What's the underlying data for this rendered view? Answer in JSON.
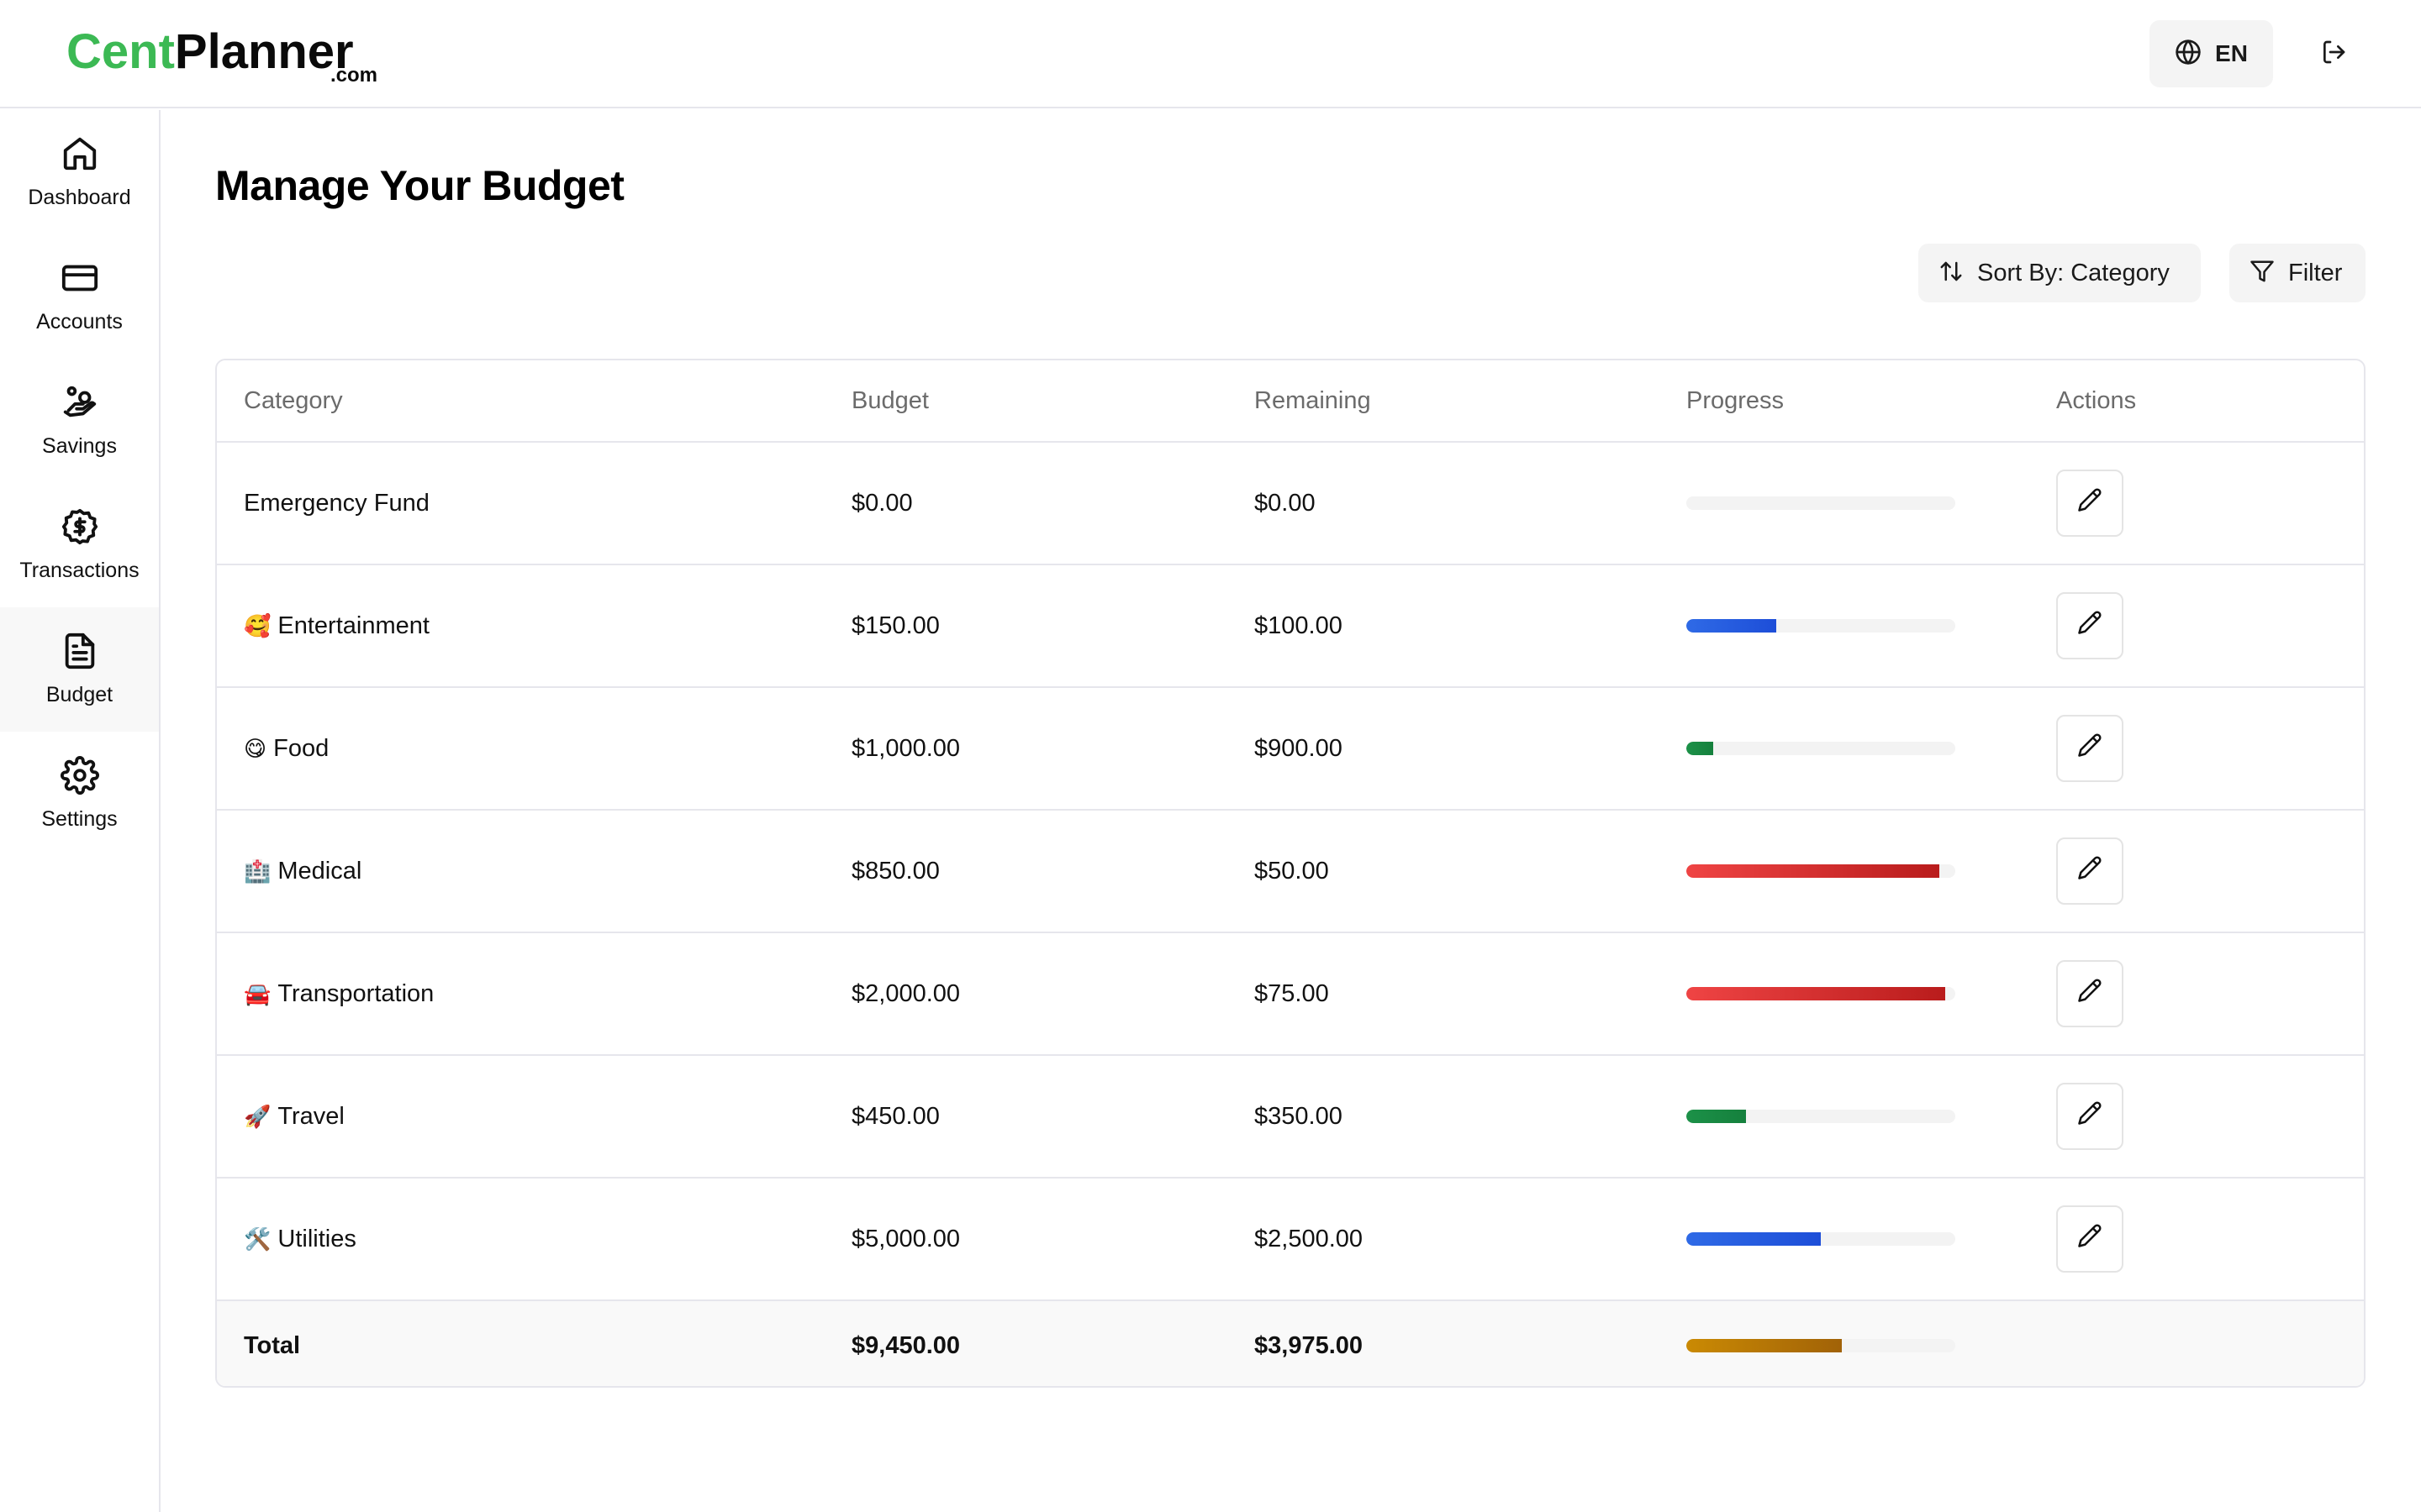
{
  "app": {
    "logo_part1": "Cent",
    "logo_part2": "Planner",
    "logo_suffix": ".com",
    "brand_color": "#3cb954"
  },
  "topbar": {
    "language_label": "EN",
    "language_icon": "globe-icon",
    "logout_icon": "logout-icon"
  },
  "sidebar": {
    "items": [
      {
        "label": "Dashboard",
        "icon": "home-icon",
        "active": false
      },
      {
        "label": "Accounts",
        "icon": "credit-card-icon",
        "active": false
      },
      {
        "label": "Savings",
        "icon": "hand-coins-icon",
        "active": false
      },
      {
        "label": "Transactions",
        "icon": "dollar-badge-icon",
        "active": false
      },
      {
        "label": "Budget",
        "icon": "file-text-icon",
        "active": true
      },
      {
        "label": "Settings",
        "icon": "gear-icon",
        "active": false
      }
    ]
  },
  "main": {
    "title": "Manage Your Budget",
    "sort_label": "Sort By: Category",
    "filter_label": "Filter"
  },
  "table": {
    "headers": {
      "category": "Category",
      "budget": "Budget",
      "remaining": "Remaining",
      "progress": "Progress",
      "actions": "Actions"
    },
    "rows": [
      {
        "emoji": "",
        "category": "Emergency Fund",
        "budget": "$0.00",
        "remaining": "$0.00",
        "progress_pct": 0,
        "bar_color": "green"
      },
      {
        "emoji": "🥰",
        "category": "Entertainment",
        "budget": "$150.00",
        "remaining": "$100.00",
        "progress_pct": 33.3,
        "bar_color": "blue"
      },
      {
        "emoji": "😋",
        "category": "Food",
        "budget": "$1,000.00",
        "remaining": "$900.00",
        "progress_pct": 10,
        "bar_color": "green"
      },
      {
        "emoji": "🏥",
        "category": "Medical",
        "budget": "$850.00",
        "remaining": "$50.00",
        "progress_pct": 94.1,
        "bar_color": "red"
      },
      {
        "emoji": "🚘",
        "category": "Transportation",
        "budget": "$2,000.00",
        "remaining": "$75.00",
        "progress_pct": 96.25,
        "bar_color": "red"
      },
      {
        "emoji": "🚀",
        "category": "Travel",
        "budget": "$450.00",
        "remaining": "$350.00",
        "progress_pct": 22.2,
        "bar_color": "green"
      },
      {
        "emoji": "🛠️",
        "category": "Utilities",
        "budget": "$5,000.00",
        "remaining": "$2,500.00",
        "progress_pct": 50,
        "bar_color": "blue"
      }
    ],
    "total": {
      "label": "Total",
      "budget": "$9,450.00",
      "remaining": "$3,975.00",
      "progress_pct": 57.9,
      "bar_color": "gold"
    }
  }
}
